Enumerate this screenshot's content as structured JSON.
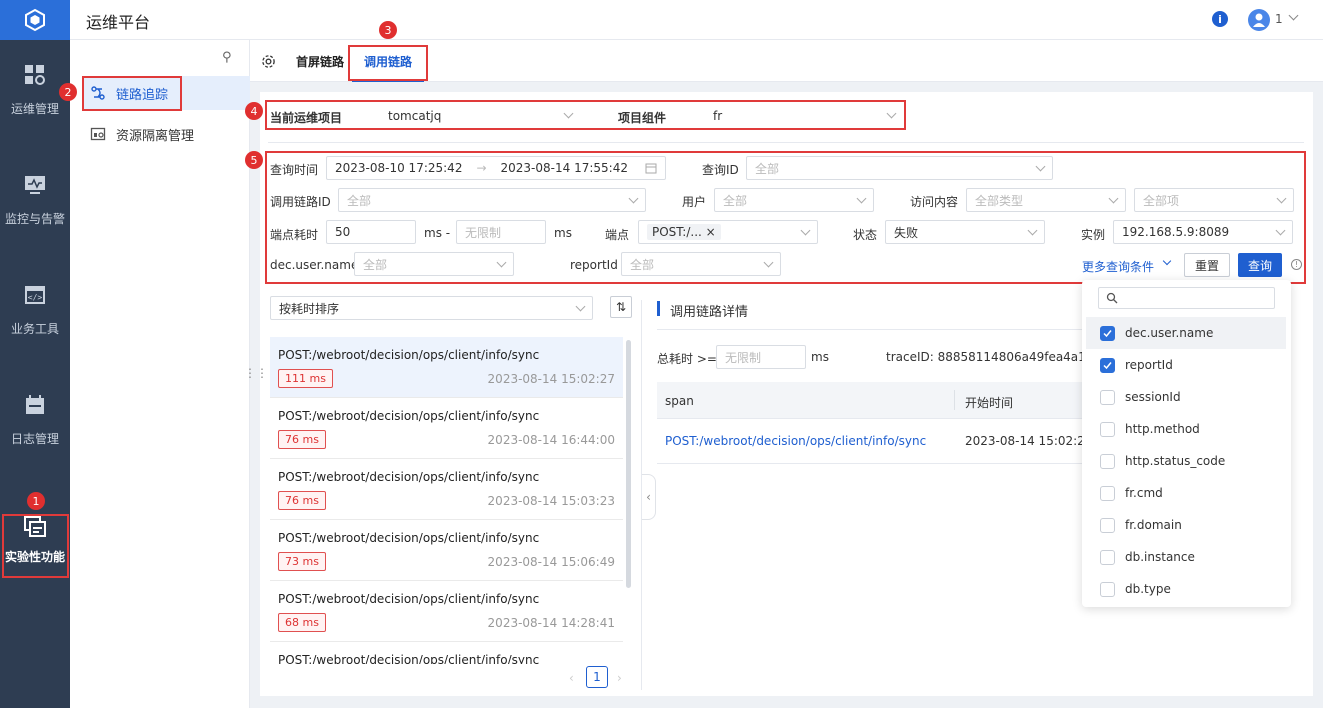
{
  "app": {
    "title": "运维平台",
    "user": "1"
  },
  "rail": [
    {
      "label": "运维管理",
      "icon": "grid-gear-icon"
    },
    {
      "label": "监控与告警",
      "icon": "monitor-icon"
    },
    {
      "label": "业务工具",
      "icon": "code-window-icon"
    },
    {
      "label": "日志管理",
      "icon": "calendar-icon"
    },
    {
      "label": "实验性功能",
      "icon": "experiment-icon",
      "active": true
    }
  ],
  "sidebar": [
    {
      "label": "链路追踪",
      "icon": "link-trace-icon",
      "active": true
    },
    {
      "label": "资源隔离管理",
      "icon": "resource-icon"
    }
  ],
  "tabs": [
    {
      "label": "首屏链路"
    },
    {
      "label": "调用链路",
      "active": true
    }
  ],
  "badges": [
    "1",
    "2",
    "3",
    "4",
    "5"
  ],
  "project": {
    "label": "当前运维项目",
    "value": "tomcatjq",
    "component_label": "项目组件",
    "component_value": "fr"
  },
  "filters": {
    "query_time_label": "查询时间",
    "time_start": "2023-08-10 17:25:42",
    "time_end": "2023-08-14 17:55:42",
    "query_id_label": "查询ID",
    "all": "全部",
    "trace_id_label": "调用链路ID",
    "user_label": "用户",
    "visit_label": "访问内容",
    "all_types": "全部类型",
    "all_items": "全部项",
    "endpoint_cost_label": "端点耗时",
    "cost_min": "50",
    "ms_dash": "ms -",
    "no_limit": "无限制",
    "ms": "ms",
    "endpoint_label": "端点",
    "endpoint_tag": "POST:/...",
    "status_label": "状态",
    "status_value": "失败",
    "instance_label": "实例",
    "instance_value": "192.168.5.9:8089",
    "dec_user_label": "dec.user.name",
    "report_label": "reportId",
    "more_label": "更多查询条件",
    "reset_label": "重置",
    "query_label": "查询"
  },
  "list": {
    "sort_label": "按耗时排序",
    "items": [
      {
        "path": "POST:/webroot/decision/ops/client/info/sync",
        "ms": "111 ms",
        "time": "2023-08-14 15:02:27"
      },
      {
        "path": "POST:/webroot/decision/ops/client/info/sync",
        "ms": "76 ms",
        "time": "2023-08-14 16:44:00"
      },
      {
        "path": "POST:/webroot/decision/ops/client/info/sync",
        "ms": "76 ms",
        "time": "2023-08-14 15:03:23"
      },
      {
        "path": "POST:/webroot/decision/ops/client/info/sync",
        "ms": "73 ms",
        "time": "2023-08-14 15:06:49"
      },
      {
        "path": "POST:/webroot/decision/ops/client/info/sync",
        "ms": "68 ms",
        "time": "2023-08-14 14:28:41"
      },
      {
        "path": "POST:/webroot/decision/ops/client/info/sync"
      }
    ],
    "page": "1"
  },
  "detail": {
    "title": "调用链路详情",
    "total_label": "总耗时 >=",
    "no_limit": "无限制",
    "ms": "ms",
    "trace_id": "traceID: 88858114806a49fea4a1fa01e",
    "col_span": "span",
    "col_start": "开始时间",
    "row_span": "POST:/webroot/decision/ops/client/info/sync",
    "row_start": "2023-08-14 15:02:27"
  },
  "dropdown": {
    "items": [
      {
        "label": "dec.user.name",
        "checked": true
      },
      {
        "label": "reportId",
        "checked": true
      },
      {
        "label": "sessionId",
        "checked": false
      },
      {
        "label": "http.method",
        "checked": false
      },
      {
        "label": "http.status_code",
        "checked": false
      },
      {
        "label": "fr.cmd",
        "checked": false
      },
      {
        "label": "fr.domain",
        "checked": false
      },
      {
        "label": "db.instance",
        "checked": false
      },
      {
        "label": "db.type",
        "checked": false
      }
    ]
  },
  "colors": {
    "accent": "#2b6fd9",
    "rail": "#2e3d52",
    "highlight": "#e03a3a"
  }
}
